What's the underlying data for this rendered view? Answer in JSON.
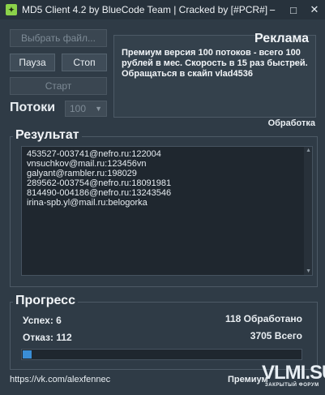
{
  "window": {
    "title": "MD5 Client 4.2 by BlueCode Team | Cracked by [#PCR#]",
    "icon": "app-logo-icon",
    "controls": {
      "minimize": "−",
      "maximize": "□",
      "close": "✕"
    }
  },
  "toolbar": {
    "select_file_label": "Выбрать файл...",
    "pause_label": "Пауза",
    "stop_label": "Стоп",
    "start_label": "Старт"
  },
  "threads": {
    "label": "Потоки",
    "value": "100"
  },
  "ad": {
    "title": "Реклама",
    "text": "Премиум версия 100 потоков - всего 100 рублей в мес. Скорость в 15 раз быстрей. Обращаться в скайп vlad4536"
  },
  "processing_label": "Обработка",
  "result": {
    "title": "Результат",
    "lines": [
      "453527-003741@nefro.ru:122004",
      "vnsuchkov@mail.ru:123456vn",
      "galyant@rambler.ru:198029",
      "289562-003754@nefro.ru:18091981",
      "814490-004186@nefro.ru:13243546",
      "irina-spb.yl@mail.ru:belogorka"
    ]
  },
  "progress": {
    "title": "Прогресс",
    "success": "Успех: 6",
    "fail": "Отказ: 112",
    "processed": "118 Обработано",
    "total": "3705 Всего",
    "fraction": 0.032
  },
  "footer": {
    "link": "https://vk.com/alexfennec",
    "right": "Премиум"
  },
  "watermark": {
    "main": "VLMI.SU",
    "sub": "ЗАКРЫТЫЙ ФОРУМ"
  },
  "colors": {
    "accent": "#3a8ed6",
    "logo": "#8bd24a",
    "background": "#2f3b46"
  }
}
